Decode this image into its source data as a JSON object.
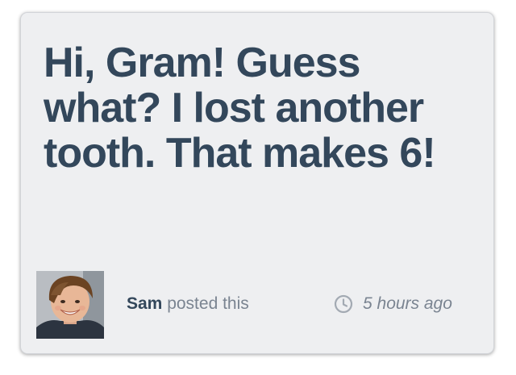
{
  "post": {
    "message": "Hi, Gram! Guess what? I lost another tooth. That makes 6!",
    "author": {
      "name": "Sam",
      "action": "posted this",
      "avatar_icon": "child-portrait"
    },
    "timestamp": "5 hours ago",
    "timestamp_icon": "clock-icon"
  },
  "colors": {
    "card_background": "#eeeff1",
    "heading_text": "#33475b",
    "secondary_text": "#7a8491"
  }
}
